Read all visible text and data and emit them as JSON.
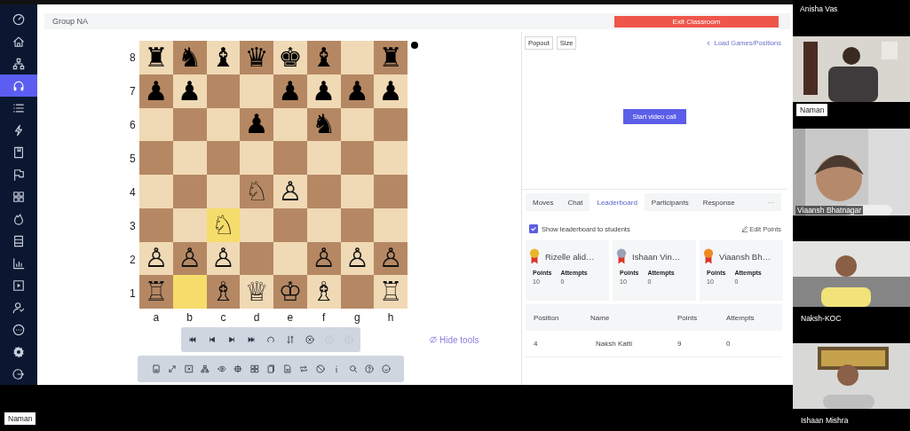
{
  "sidebar": {
    "items": [
      {
        "selected": false
      },
      {
        "selected": false
      },
      {
        "selected": false
      },
      {
        "selected": true
      },
      {
        "selected": false
      },
      {
        "selected": false
      },
      {
        "selected": false
      },
      {
        "selected": false
      },
      {
        "selected": false
      },
      {
        "selected": false
      },
      {
        "selected": false
      },
      {
        "selected": false
      },
      {
        "selected": false
      },
      {
        "selected": false
      },
      {
        "selected": false
      },
      {
        "selected": false
      },
      {
        "selected": false
      }
    ]
  },
  "header": {
    "title": "Group NA",
    "exit_button": "Exit Classroom"
  },
  "board": {
    "ranks": [
      {
        "label": "8",
        "squares": [
          {
            "piece": "♜",
            "highlighted": false
          },
          {
            "piece": "♞",
            "highlighted": false
          },
          {
            "piece": "♝",
            "highlighted": false
          },
          {
            "piece": "♛",
            "highlighted": false
          },
          {
            "piece": "♚",
            "highlighted": false
          },
          {
            "piece": "♝",
            "highlighted": false
          },
          {
            "highlighted": false
          },
          {
            "piece": "♜",
            "highlighted": false
          }
        ]
      },
      {
        "label": "7",
        "squares": [
          {
            "piece": "♟",
            "highlighted": false
          },
          {
            "piece": "♟",
            "highlighted": false
          },
          {
            "highlighted": false
          },
          {
            "highlighted": false
          },
          {
            "piece": "♟",
            "highlighted": false
          },
          {
            "piece": "♟",
            "highlighted": false
          },
          {
            "piece": "♟",
            "highlighted": false
          },
          {
            "piece": "♟",
            "highlighted": false
          }
        ]
      },
      {
        "label": "6",
        "squares": [
          {
            "highlighted": false
          },
          {
            "highlighted": false
          },
          {
            "highlighted": false
          },
          {
            "piece": "♟",
            "highlighted": false
          },
          {
            "highlighted": false
          },
          {
            "piece": "♞",
            "highlighted": false
          },
          {
            "highlighted": false
          },
          {
            "highlighted": false
          }
        ]
      },
      {
        "label": "5",
        "squares": [
          {
            "highlighted": false
          },
          {
            "highlighted": false
          },
          {
            "highlighted": false
          },
          {
            "highlighted": false
          },
          {
            "highlighted": false
          },
          {
            "highlighted": false
          },
          {
            "highlighted": false
          },
          {
            "highlighted": false
          }
        ]
      },
      {
        "label": "4",
        "squares": [
          {
            "highlighted": false
          },
          {
            "highlighted": false
          },
          {
            "highlighted": false
          },
          {
            "piece": "♘",
            "highlighted": false
          },
          {
            "piece": "♙",
            "highlighted": false
          },
          {
            "highlighted": false
          },
          {
            "highlighted": false
          },
          {
            "highlighted": false
          }
        ]
      },
      {
        "label": "3",
        "squares": [
          {
            "highlighted": false
          },
          {
            "highlighted": false
          },
          {
            "piece": "♘",
            "highlighted": true
          },
          {
            "highlighted": false
          },
          {
            "highlighted": false
          },
          {
            "highlighted": false
          },
          {
            "highlighted": false
          },
          {
            "highlighted": false
          }
        ]
      },
      {
        "label": "2",
        "squares": [
          {
            "piece": "♙",
            "highlighted": false
          },
          {
            "piece": "♙",
            "highlighted": false
          },
          {
            "piece": "♙",
            "highlighted": false
          },
          {
            "highlighted": false
          },
          {
            "highlighted": false
          },
          {
            "piece": "♙",
            "highlighted": false
          },
          {
            "piece": "♙",
            "highlighted": false
          },
          {
            "piece": "♙",
            "highlighted": false
          }
        ]
      },
      {
        "label": "1",
        "squares": [
          {
            "piece": "♖",
            "highlighted": false
          },
          {
            "highlighted": true
          },
          {
            "piece": "♗",
            "highlighted": false
          },
          {
            "piece": "♕",
            "highlighted": false
          },
          {
            "piece": "♔",
            "highlighted": false
          },
          {
            "piece": "♗",
            "highlighted": false
          },
          {
            "highlighted": false
          },
          {
            "piece": "♖",
            "highlighted": false
          }
        ]
      }
    ],
    "files": [
      "a",
      "b",
      "c",
      "d",
      "e",
      "f",
      "g",
      "h"
    ]
  },
  "nav_tools": [
    {
      "disabled": false
    },
    {
      "disabled": false
    },
    {
      "disabled": false
    },
    {
      "disabled": false
    },
    {
      "disabled": false
    },
    {
      "disabled": false
    },
    {
      "disabled": false
    },
    {
      "disabled": true
    },
    {
      "disabled": true
    }
  ],
  "hide_tools": "Hide tools",
  "video_area": {
    "buttons": [
      "Popout",
      "Size"
    ],
    "load_link": "Load Games/Positions",
    "start_button": "Start video call"
  },
  "tabs": [
    {
      "label": "Moves",
      "selected": false
    },
    {
      "label": "Chat",
      "selected": false
    },
    {
      "label": "Leaderboard",
      "selected": true
    },
    {
      "label": "Participants",
      "selected": false
    },
    {
      "label": "Response",
      "selected": false
    },
    {
      "label": "···",
      "selected": false
    }
  ],
  "leaderboard": {
    "show_to_students": {
      "label": "Show leaderboard to students",
      "checked": true
    },
    "edit_link": "Edit Points",
    "top": [
      {
        "name": "Rizelle alid…",
        "color": "#e8b62a",
        "points_label": "Points",
        "attempts_label": "Attempts",
        "points": "10",
        "attempts": "0"
      },
      {
        "name": "Ishaan Vin…",
        "color": "#9aa3b5",
        "points_label": "Points",
        "attempts_label": "Attempts",
        "points": "10",
        "attempts": "0"
      },
      {
        "name": "Viaansh Bh…",
        "color": "#f08a24",
        "points_label": "Points",
        "attempts_label": "Attempts",
        "points": "10",
        "attempts": "0"
      }
    ],
    "columns": [
      "Position",
      "Name",
      "Points",
      "Attempts"
    ],
    "rows": [
      [
        "4",
        "Naksh Katti",
        "9",
        "0"
      ]
    ]
  },
  "videos": [
    {
      "name": "Anisha Vas",
      "kind": "none"
    },
    {
      "name": "Naman",
      "kind": "boxed"
    },
    {
      "name": "Viaansh Bhatnagar",
      "kind": "overlay"
    },
    {
      "name": "Naksh-KOC",
      "kind": "below"
    },
    {
      "name": "Ishaan Mishra",
      "kind": "below"
    }
  ],
  "self_label": "Naman"
}
